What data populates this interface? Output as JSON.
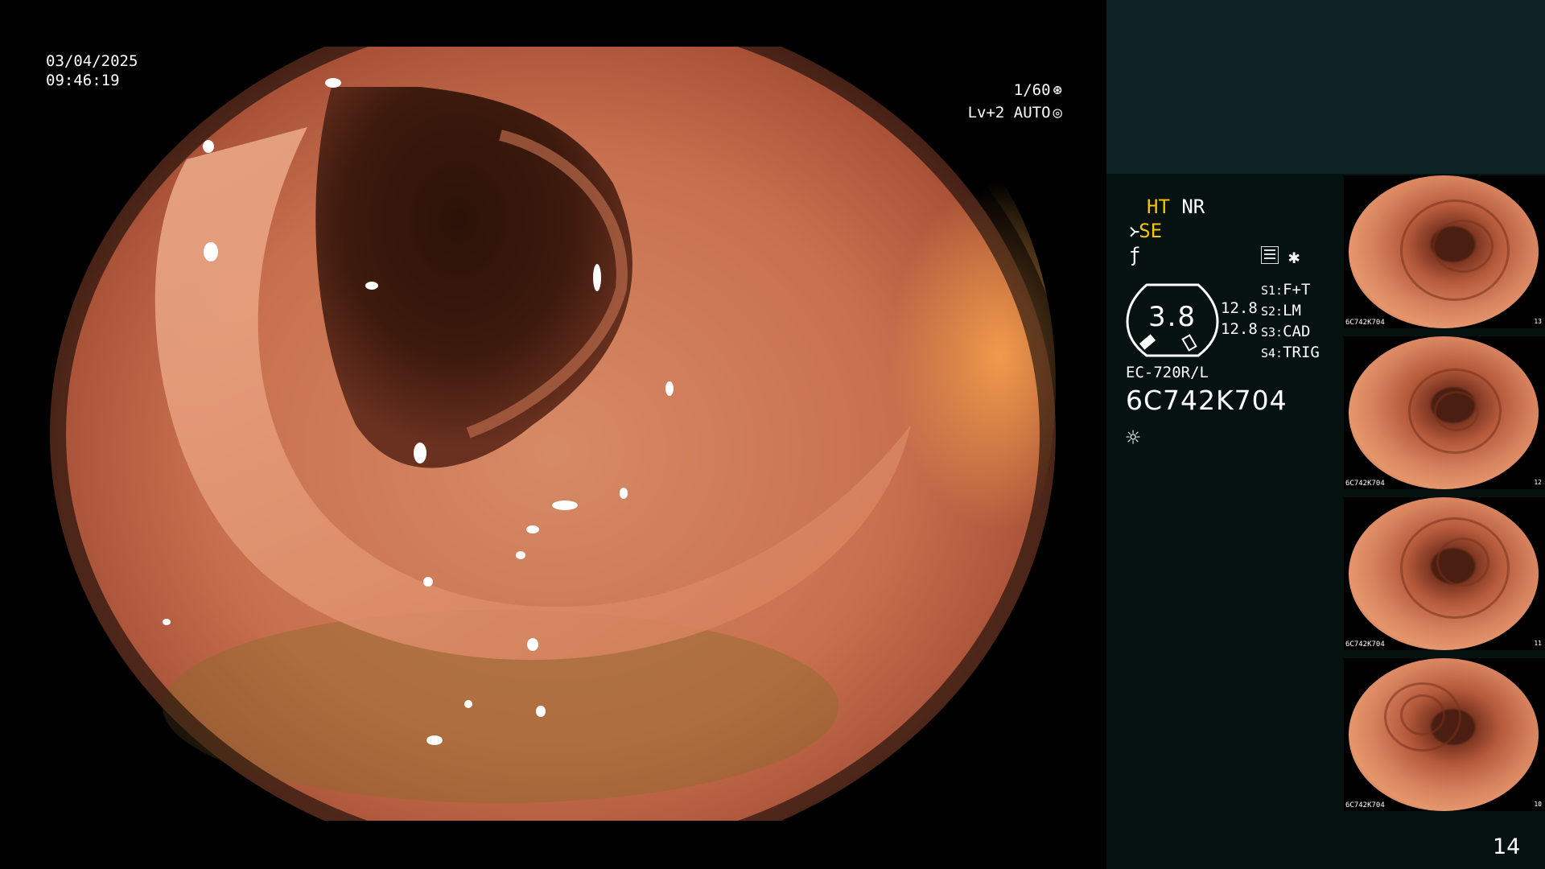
{
  "overlay": {
    "date": "03/04/2025",
    "time": "09:46:19",
    "shutter": "1/60",
    "level": "Lv+2 AUTO"
  },
  "panel": {
    "ht": "HT",
    "nr": "NR",
    "se": "SE",
    "gauge_value": "3.8",
    "readout_1": "12.8",
    "readout_2": "12.8",
    "scope_modes": [
      {
        "label": "S1:",
        "value": "F+T"
      },
      {
        "label": "S2:",
        "value": "LM"
      },
      {
        "label": "S3:",
        "value": "CAD"
      },
      {
        "label": "S4:",
        "value": "TRIG"
      }
    ],
    "scope_model": "EC-720R/L",
    "scope_serial": "6C742K704",
    "page_number": "14"
  },
  "thumbnails": [
    {
      "serial": "6C742K704",
      "index": "13"
    },
    {
      "serial": "6C742K704",
      "index": "12"
    },
    {
      "serial": "6C742K704",
      "index": "11"
    },
    {
      "serial": "6C742K704",
      "index": "10"
    }
  ],
  "colors": {
    "accent_yellow": "#f5c400",
    "panel_top": "#0d2326",
    "panel": "#061210"
  },
  "icons": [
    "shutter-icon",
    "auto-iris-icon",
    "scissors-icon",
    "f-icon",
    "grid-icon",
    "star-icon",
    "light-icon"
  ]
}
